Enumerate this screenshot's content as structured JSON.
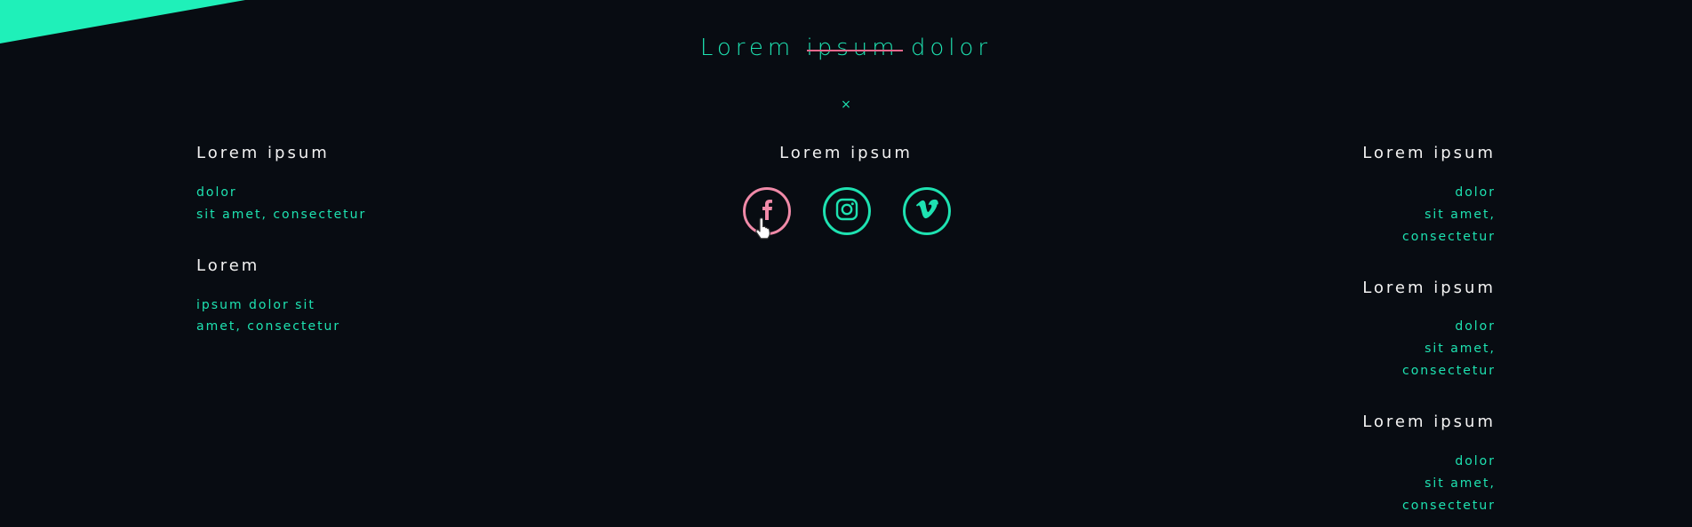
{
  "page_title": {
    "before": "Lorem",
    "struck": "ipsum",
    "after": "dolor"
  },
  "close_label": "×",
  "left": {
    "heading1": "Lorem ipsum",
    "links1": [
      "dolor",
      "sit amet, consectetur"
    ],
    "heading2": "Lorem",
    "links2": [
      "ipsum dolor sit",
      "amet, consectetur"
    ]
  },
  "center": {
    "heading": "Lorem ipsum",
    "social": [
      "facebook-icon",
      "instagram-icon",
      "vimeo-icon"
    ]
  },
  "right": {
    "sections": [
      {
        "heading": "Lorem ipsum",
        "links": [
          "dolor",
          "sit amet,",
          "consectetur"
        ]
      },
      {
        "heading": "Lorem ipsum",
        "links": [
          "dolor",
          "sit amet,",
          "consectetur"
        ]
      },
      {
        "heading": "Lorem ipsum",
        "links": [
          "dolor",
          "sit amet,",
          "consectetur"
        ]
      }
    ]
  },
  "colors": {
    "background": "#080c12",
    "accent": "#1ee2b1",
    "hover": "#f08aa8",
    "strike": "#e6688c"
  }
}
